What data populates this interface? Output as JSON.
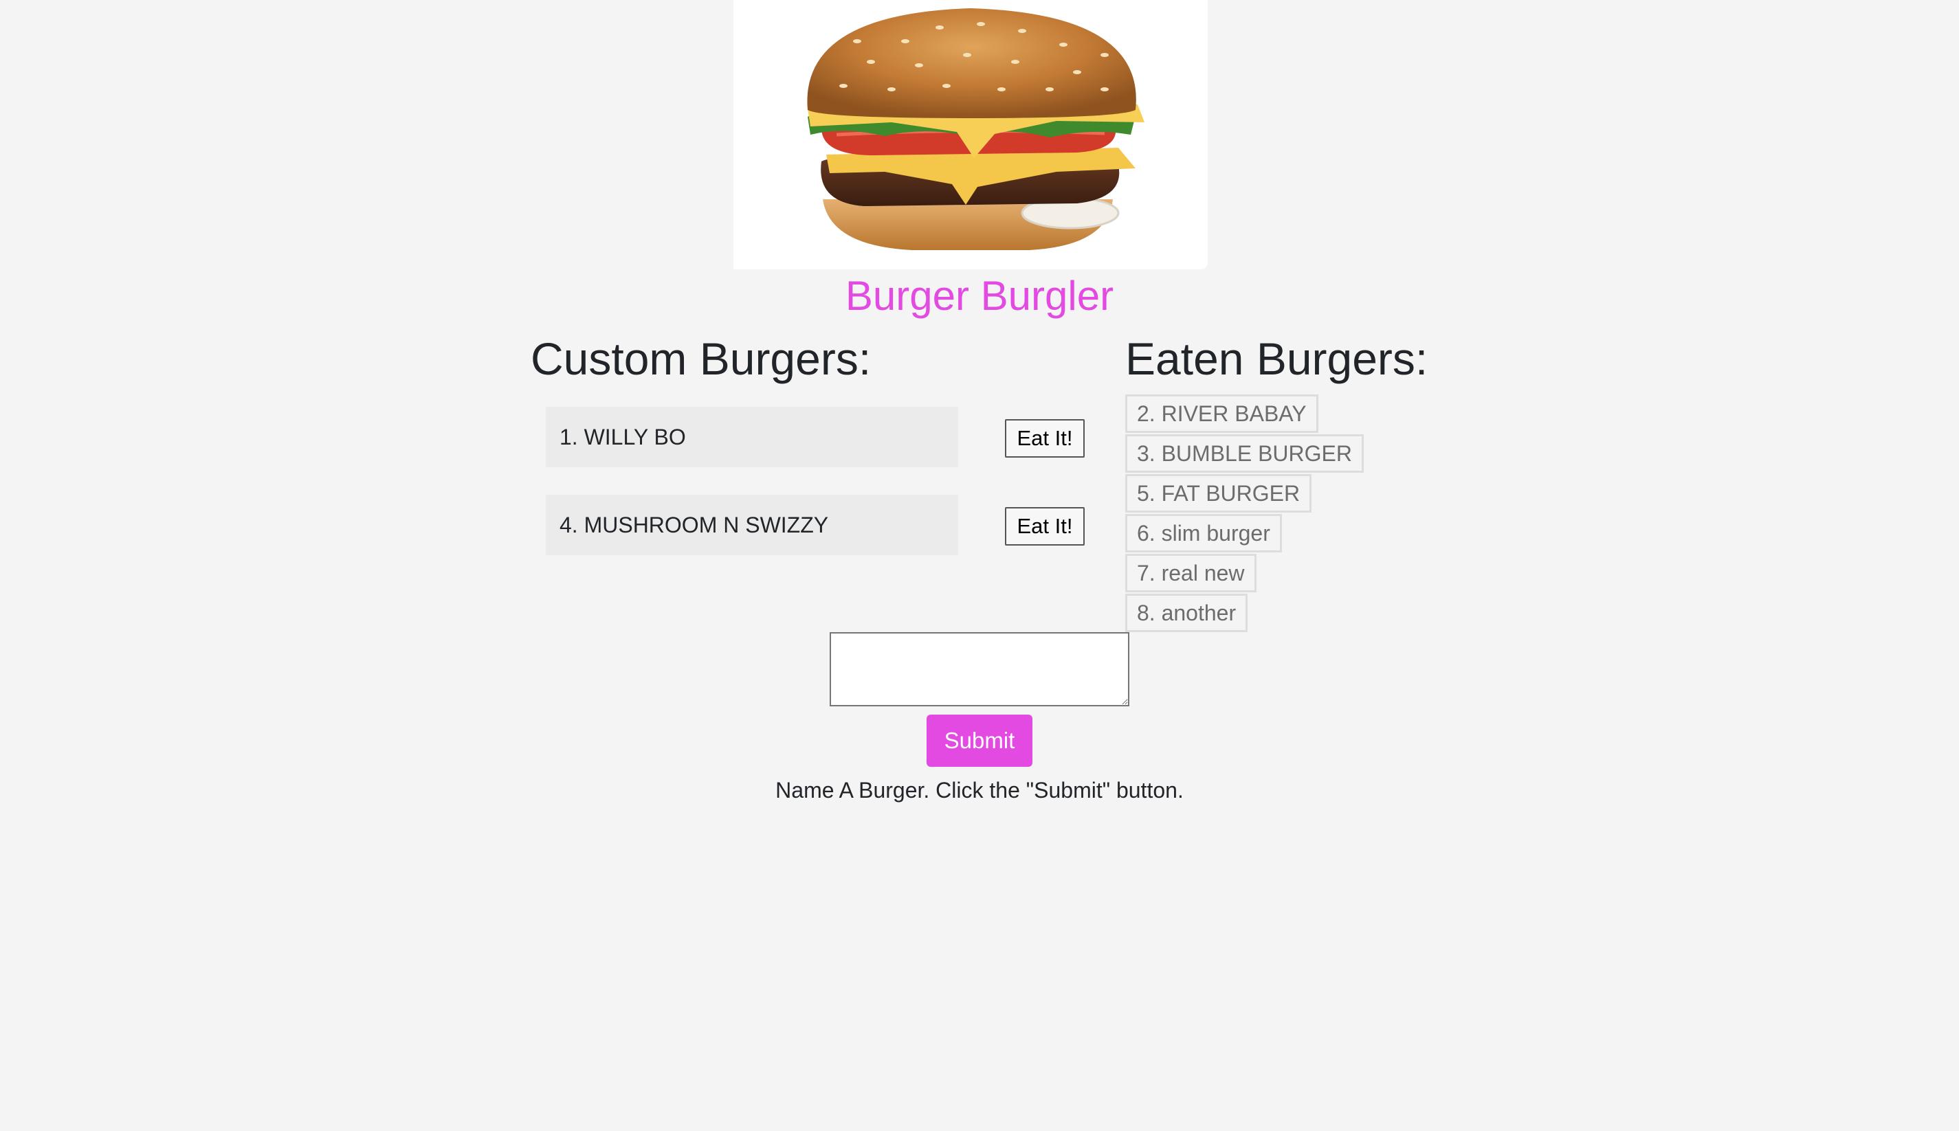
{
  "app": {
    "title": "Burger Burgler"
  },
  "hero": {
    "icon": "hamburger-image"
  },
  "custom": {
    "heading": "Custom Burgers:",
    "items": [
      {
        "label": "1. WILLY BO",
        "button": "Eat It!"
      },
      {
        "label": "4. MUSHROOM N SWIZZY",
        "button": "Eat It!"
      }
    ]
  },
  "eaten": {
    "heading": "Eaten Burgers:",
    "items": [
      "2. RIVER BABAY",
      "3. BUMBLE BURGER",
      "5. FAT BURGER",
      "6. slim burger",
      "7. real new",
      "8. another"
    ]
  },
  "form": {
    "input_value": "",
    "submit_label": "Submit",
    "instructions": "Name A Burger. Click the \"Submit\" button."
  },
  "colors": {
    "accent": "#e24ae1",
    "background": "#f4f4f4",
    "card": "#ebebeb"
  }
}
